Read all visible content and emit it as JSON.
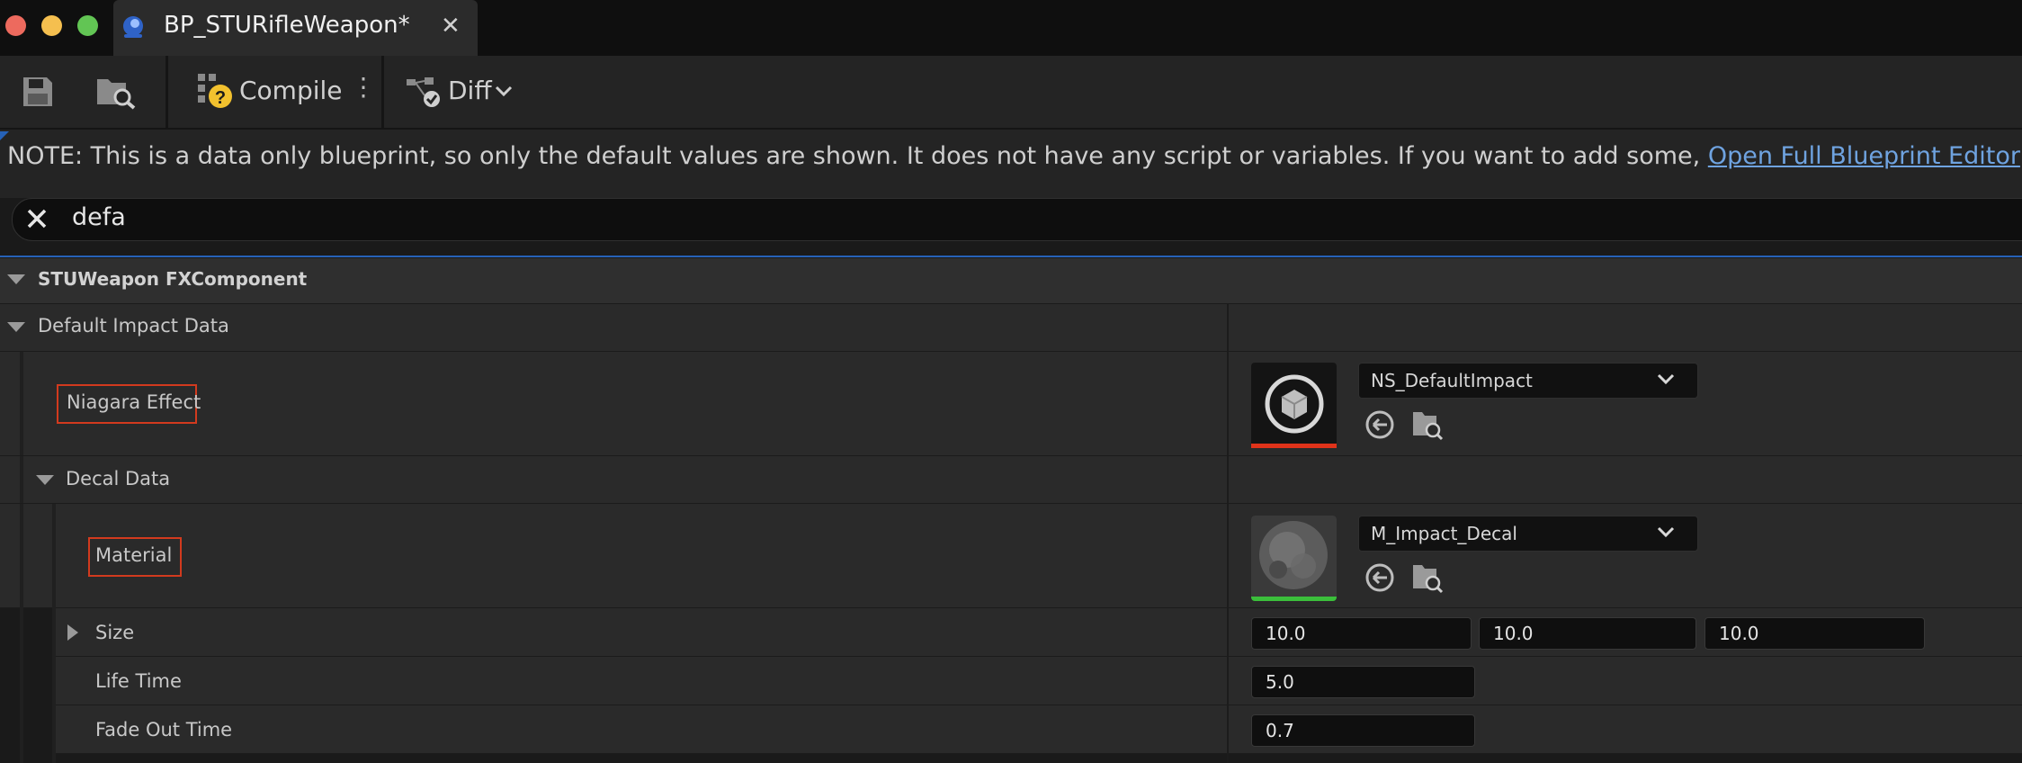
{
  "window": {
    "tab_title": "BP_STURifleWeapon*",
    "tab_close": "✕",
    "traffic_lights": {
      "close": "#ed6a5e",
      "minimize": "#f5bf4f",
      "maximize": "#62c554"
    }
  },
  "toolbar": {
    "compile_label": "Compile",
    "compile_more": "⋮",
    "diff_label": "Diff"
  },
  "notice": {
    "text": "NOTE: This is a data only blueprint, so only the default values are shown.  It does not have any script or variables.  If you want to add some, ",
    "link": "Open Full Blueprint Editor"
  },
  "search": {
    "value": "defa"
  },
  "details": {
    "category": "STUWeapon FXComponent",
    "group": "Default Impact Data",
    "niagara_effect": {
      "label": "Niagara Effect",
      "asset": "NS_DefaultImpact",
      "thumb_bar_color": "#e0331a"
    },
    "decal_data": {
      "label": "Decal Data",
      "material": {
        "label": "Material",
        "asset": "M_Impact_Decal",
        "thumb_bar_color": "#3bbf3b"
      },
      "size": {
        "label": "Size",
        "x": "10.0",
        "y": "10.0",
        "z": "10.0"
      },
      "life_time": {
        "label": "Life Time",
        "value": "5.0"
      },
      "fade_out_time": {
        "label": "Fade Out Time",
        "value": "0.7"
      }
    }
  },
  "colors": {
    "link": "#6fa3e0",
    "highlight_box": "#d23a1e",
    "accent_line": "#2662b8"
  }
}
